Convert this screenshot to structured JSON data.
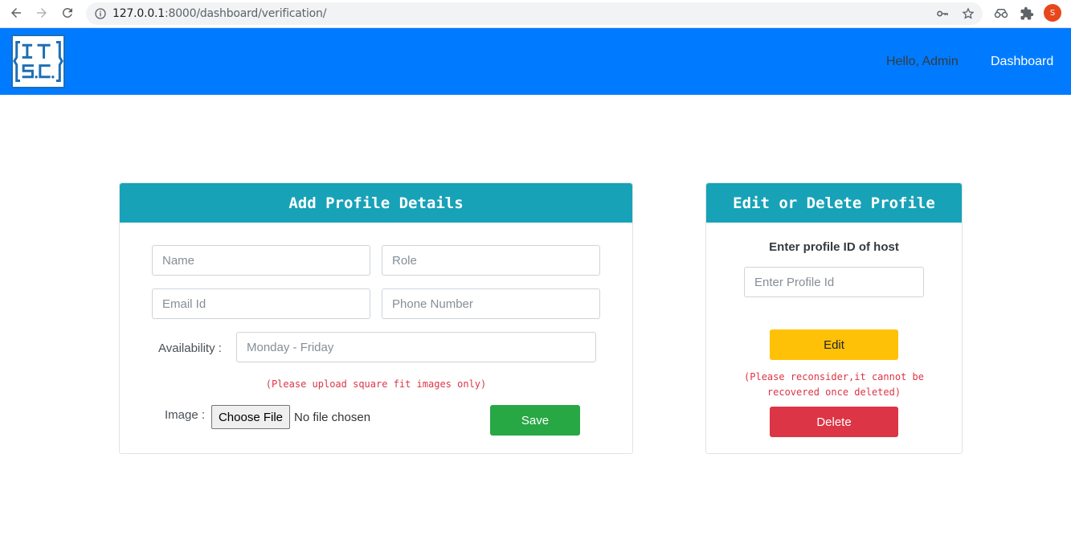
{
  "browser": {
    "url_host": "127.0.0.1",
    "url_rest": ":8000/dashboard/verification/",
    "profile_initial": "S"
  },
  "navbar": {
    "logo_text_top": "IT",
    "logo_text_bottom": "SC",
    "greeting": "Hello, Admin",
    "dashboard_link": "Dashboard",
    "brand_color": "#007bff"
  },
  "add_profile": {
    "title": "Add Profile Details",
    "name_placeholder": "Name",
    "role_placeholder": "Role",
    "email_placeholder": "Email Id",
    "phone_placeholder": "Phone Number",
    "availability_label": "Availability :",
    "availability_placeholder": "Monday - Friday",
    "image_note": "(Please upload square fit images only)",
    "image_label": "Image :",
    "choose_file_label": "Choose File",
    "file_status": "No file chosen",
    "save_label": "Save"
  },
  "edit_profile": {
    "title": "Edit or Delete Profile",
    "prompt": "Enter profile ID of host",
    "id_placeholder": "Enter Profile Id",
    "edit_label": "Edit",
    "delete_warning_line1": "(Please reconsider,it cannot be",
    "delete_warning_line2": "recovered once deleted)",
    "delete_label": "Delete"
  }
}
